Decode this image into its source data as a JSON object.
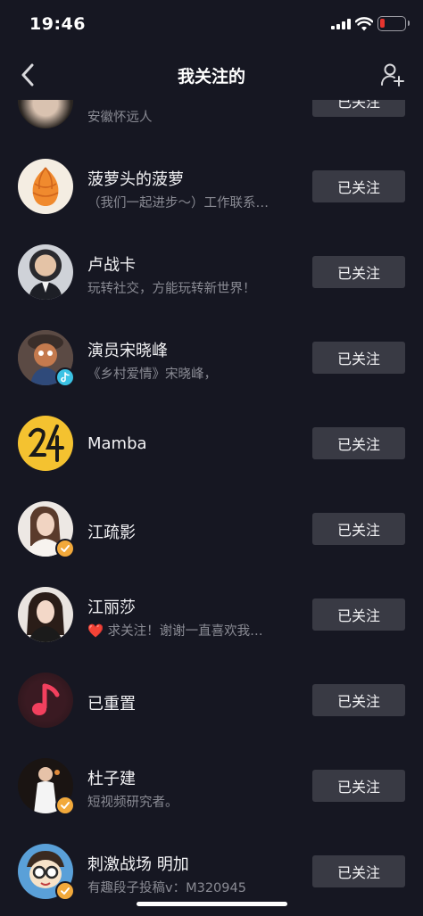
{
  "status_bar": {
    "time": "19:46"
  },
  "nav": {
    "title": "我关注的"
  },
  "partial_row": {
    "bio": "安徽怀远人"
  },
  "follow_label": "已关注",
  "rows": [
    {
      "name": "菠萝头的菠萝",
      "bio": "（我们一起进步～）工作联系…",
      "avatar": "pinecone",
      "badge": ""
    },
    {
      "name": "卢战卡",
      "bio": "玩转社交，方能玩转新世界！",
      "avatar": "man-suit",
      "badge": ""
    },
    {
      "name": "演员宋晓峰",
      "bio": "《乡村爱情》宋晓峰，",
      "avatar": "cartoon-man",
      "badge": "tiktok"
    },
    {
      "name": "Mamba",
      "bio": "",
      "avatar": "number-24",
      "badge": ""
    },
    {
      "name": "江疏影",
      "bio": "",
      "avatar": "woman-1",
      "badge": "verified"
    },
    {
      "name": "江丽莎",
      "bio": "❤️ 求关注！谢谢一直喜欢我…",
      "avatar": "woman-2",
      "badge": ""
    },
    {
      "name": "已重置",
      "bio": "",
      "avatar": "music-note",
      "badge": ""
    },
    {
      "name": "杜子建",
      "bio": "短视频研究者。",
      "avatar": "man-stage",
      "badge": "verified"
    },
    {
      "name": "刺激战场 明加",
      "bio": "有趣段子投稿v：M320945",
      "avatar": "cartoon-glasses",
      "badge": "verified"
    }
  ],
  "colors": {
    "background": "#161722",
    "button": "#393a44",
    "verified": "#f2a93b",
    "battery_low": "#e8352f"
  }
}
